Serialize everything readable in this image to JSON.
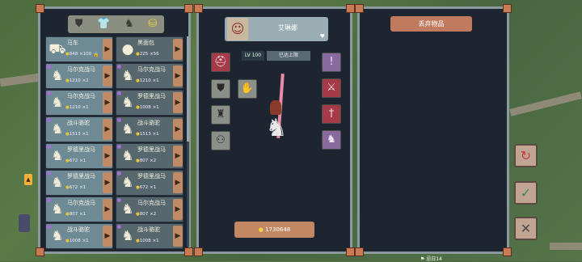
{
  "left_panel": {
    "category_tabs": [
      {
        "icon": "armor-icon",
        "glyph": "⛊",
        "selected": false
      },
      {
        "icon": "shirt-icon",
        "glyph": "👕",
        "selected": false
      },
      {
        "icon": "horse-head-icon",
        "glyph": "♞",
        "selected": false
      },
      {
        "icon": "coins-icon",
        "glyph": "⛁",
        "selected": true
      }
    ],
    "items": [
      {
        "name": "马车",
        "gold": "848",
        "qty": "×100",
        "dark": false,
        "gem": false,
        "glyph": "⛟",
        "locked": true
      },
      {
        "name": "黑面包",
        "gold": "225",
        "qty": "×56",
        "dark": true,
        "gem": false,
        "glyph": "●",
        "locked": false
      },
      {
        "name": "马尔克战马",
        "gold": "1210",
        "qty": "×2",
        "dark": false,
        "gem": true,
        "glyph": "♞",
        "locked": false
      },
      {
        "name": "马尔克战马",
        "gold": "1210",
        "qty": "×1",
        "dark": true,
        "gem": true,
        "glyph": "♞",
        "locked": false
      },
      {
        "name": "马尔克战马",
        "gold": "1210",
        "qty": "×1",
        "dark": false,
        "gem": true,
        "glyph": "♞",
        "locked": false
      },
      {
        "name": "罗德里战马",
        "gold": "1008",
        "qty": "×1",
        "dark": true,
        "gem": true,
        "glyph": "♞",
        "locked": false
      },
      {
        "name": "战斗骆驼",
        "gold": "1513",
        "qty": "×1",
        "dark": false,
        "gem": true,
        "glyph": "♞",
        "locked": false
      },
      {
        "name": "战斗骆驼",
        "gold": "1513",
        "qty": "×1",
        "dark": true,
        "gem": true,
        "glyph": "♞",
        "locked": false
      },
      {
        "name": "罗德里战马",
        "gold": "672",
        "qty": "×1",
        "dark": false,
        "gem": true,
        "glyph": "♞",
        "locked": false
      },
      {
        "name": "罗德里战马",
        "gold": "807",
        "qty": "×2",
        "dark": true,
        "gem": true,
        "glyph": "♞",
        "locked": false
      },
      {
        "name": "罗德里战马",
        "gold": "672",
        "qty": "×1",
        "dark": false,
        "gem": true,
        "glyph": "♞",
        "locked": false
      },
      {
        "name": "罗德里战马",
        "gold": "672",
        "qty": "×1",
        "dark": true,
        "gem": true,
        "glyph": "♞",
        "locked": false
      },
      {
        "name": "马尔克战马",
        "gold": "807",
        "qty": "×1",
        "dark": false,
        "gem": true,
        "glyph": "♞",
        "locked": false
      },
      {
        "name": "马尔克战马",
        "gold": "807",
        "qty": "×2",
        "dark": true,
        "gem": true,
        "glyph": "♞",
        "locked": false
      },
      {
        "name": "战斗骆驼",
        "gold": "1008",
        "qty": "×1",
        "dark": false,
        "gem": true,
        "glyph": "♞",
        "locked": false
      },
      {
        "name": "战斗骆驼",
        "gold": "1008",
        "qty": "×1",
        "dark": true,
        "gem": true,
        "glyph": "♞",
        "locked": false
      }
    ]
  },
  "character": {
    "name": "艾琳娜",
    "level": "LV 100",
    "level_status": "已达上限",
    "gold": "1730648"
  },
  "right_panel": {
    "discard_label": "丢弃物品"
  },
  "side_buttons": {
    "rotate": "↻",
    "confirm": "✓",
    "close": "✕"
  },
  "footer_text": "⚑ 忌日14"
}
